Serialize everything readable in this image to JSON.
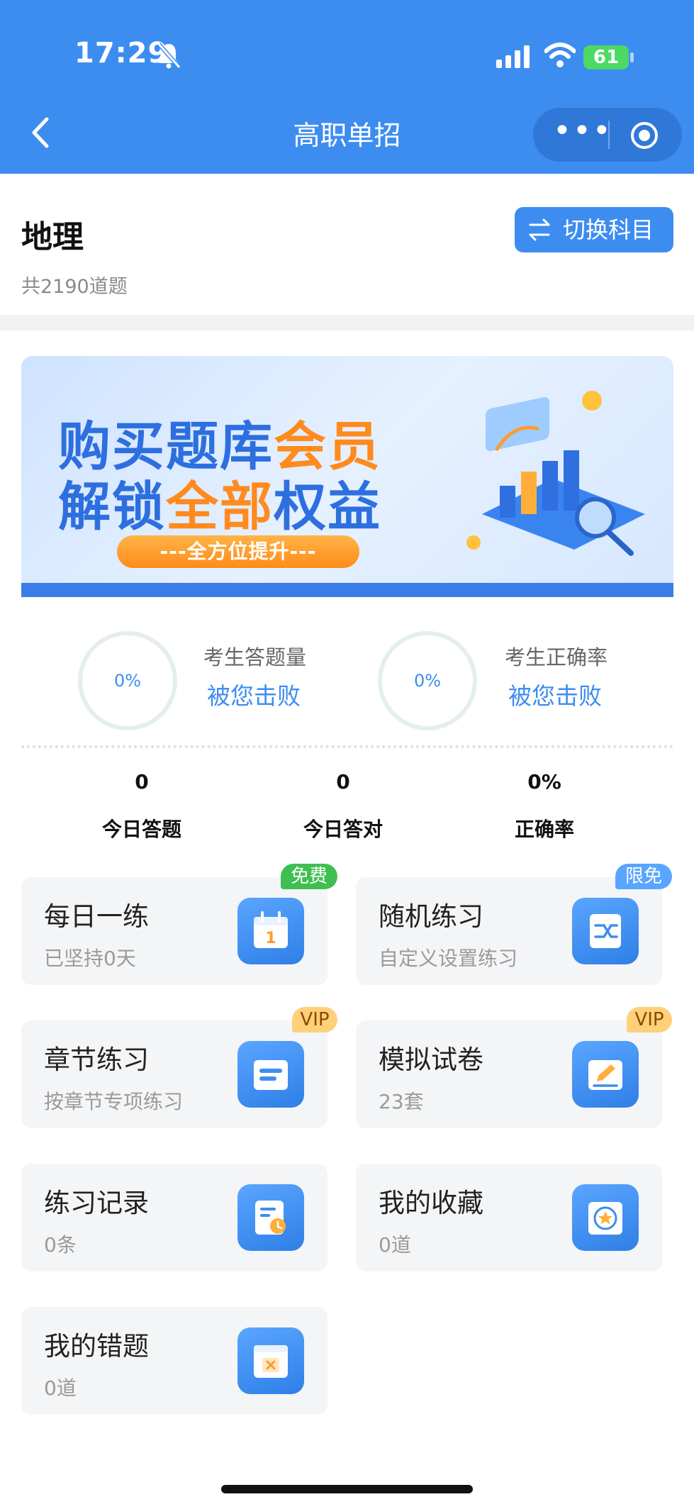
{
  "status_bar": {
    "time": "17:29",
    "battery": "61"
  },
  "nav": {
    "title": "高职单招",
    "more_icon": "•••"
  },
  "subject": {
    "name": "地理",
    "count": "共2190道题",
    "switch_label": "切换科目"
  },
  "banner": {
    "line1_a": "购买题库",
    "line1_b": "会员",
    "line2_a": "解锁",
    "line2_b": "全部",
    "line2_c": "权益",
    "pill": "---全方位提升---"
  },
  "stats": {
    "ring1": "0%",
    "label1": "考生答题量",
    "beat1": "被您击败",
    "ring2": "0%",
    "label2": "考生正确率",
    "beat2": "被您击败"
  },
  "today": [
    {
      "value": "0",
      "label": "今日答题"
    },
    {
      "value": "0",
      "label": "今日答对"
    },
    {
      "value": "0%",
      "label": "正确率"
    }
  ],
  "cards": [
    {
      "title": "每日一练",
      "sub": "已坚持0天",
      "tag": "免费",
      "icon": "calendar-icon"
    },
    {
      "title": "随机练习",
      "sub": "自定义设置练习",
      "tag": "限免",
      "icon": "shuffle-icon"
    },
    {
      "title": "章节练习",
      "sub": "按章节专项练习",
      "tag": "VIP",
      "icon": "folder-icon"
    },
    {
      "title": "模拟试卷",
      "sub": "23套",
      "tag": "VIP",
      "icon": "pen-icon"
    },
    {
      "title": "练习记录",
      "sub": "0条",
      "tag": "",
      "icon": "clock-doc-icon"
    },
    {
      "title": "我的收藏",
      "sub": "0道",
      "tag": "",
      "icon": "star-icon"
    },
    {
      "title": "我的错题",
      "sub": "0道",
      "tag": "",
      "icon": "wrong-icon"
    }
  ],
  "colors": {
    "primary": "#3d8df0",
    "free": "#3fbf4f",
    "vip": "#ffd07a",
    "banner_orange": "#ff8a1e"
  }
}
